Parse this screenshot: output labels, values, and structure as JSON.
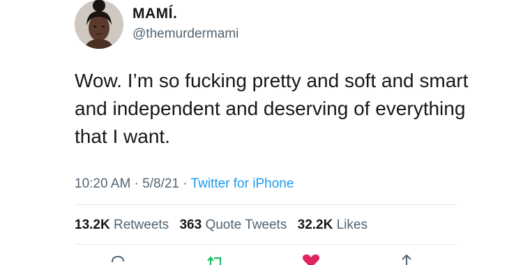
{
  "tweet": {
    "display_name": "MAMÍ.",
    "handle": "@themurdermami",
    "text": "Wow. I’m so fucking pretty and soft and smart and independent and deserving of everything that I want.",
    "time": "10:20 AM",
    "separator": "·",
    "date": "5/8/21",
    "source": "Twitter for iPhone"
  },
  "stats": {
    "retweets_count": "13.2K",
    "retweets_label": "Retweets",
    "quote_count": "363",
    "quote_label": "Quote Tweets",
    "likes_count": "32.2K",
    "likes_label": "Likes"
  },
  "actions": [
    {
      "icon": "reply-icon"
    },
    {
      "icon": "retweet-icon",
      "color": "#17bf63"
    },
    {
      "icon": "like-icon",
      "color": "#e0245e"
    },
    {
      "icon": "share-icon"
    }
  ]
}
